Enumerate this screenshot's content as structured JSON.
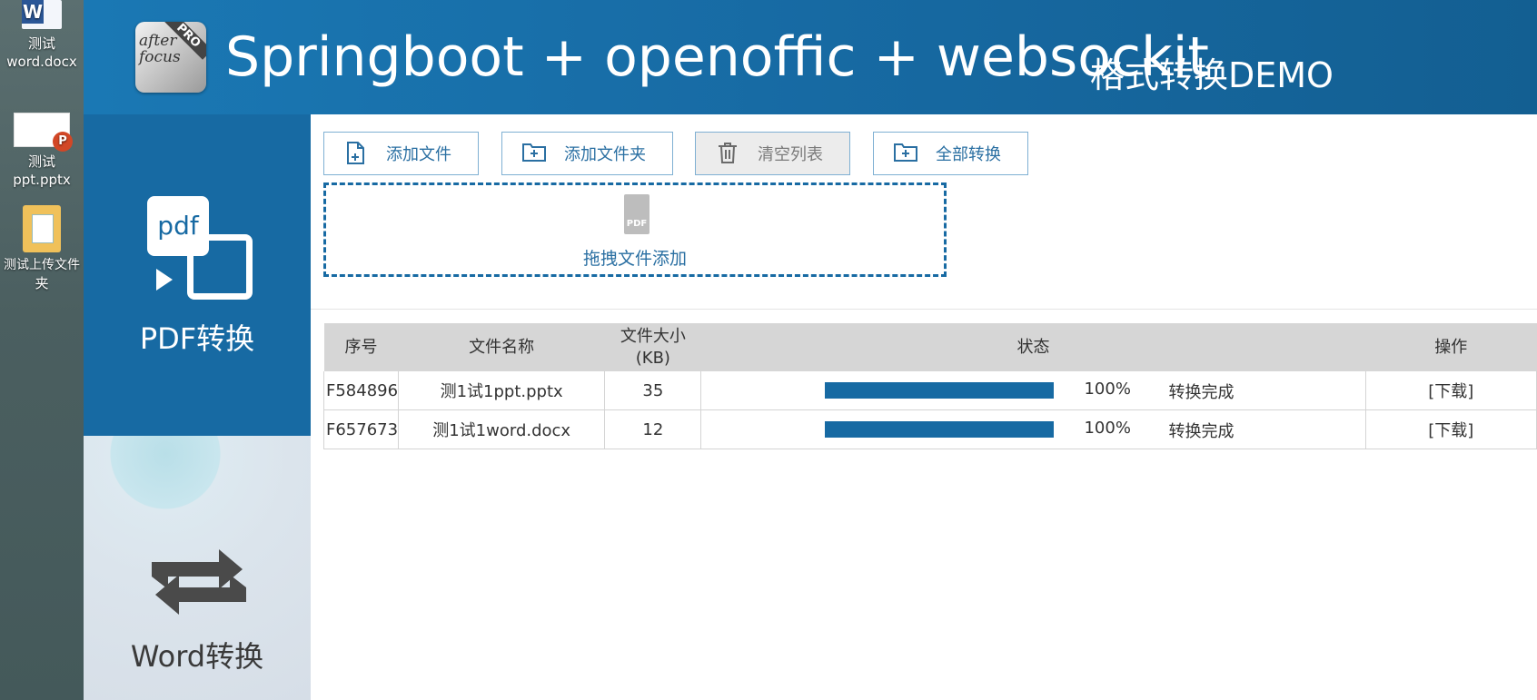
{
  "desktop": {
    "icons": [
      {
        "label_line1": "测试",
        "label_line2": "word.docx",
        "badge": "W"
      },
      {
        "label_line1": "测试",
        "label_line2": "ppt.pptx",
        "badge": "P"
      },
      {
        "label_line1": "测试上传文件",
        "label_line2": "夹"
      }
    ]
  },
  "header": {
    "logo_text": "after focus",
    "logo_badge": "PRO",
    "title": "Springboot + openoffic + websockit",
    "subtitle": "格式转换DEMO"
  },
  "sidebar": {
    "pdf_icon_text": "pdf",
    "pdf_label": "PDF转换",
    "word_label": "Word转换",
    "word_icon": "repeat-icon"
  },
  "toolbar": {
    "add_file": "添加文件",
    "add_folder": "添加文件夹",
    "clear_list": "清空列表",
    "convert_all": "全部转换"
  },
  "dropzone": {
    "icon_text": "PDF",
    "text": "拖拽文件添加"
  },
  "table": {
    "headers": {
      "index": "序号",
      "name": "文件名称",
      "size_line1": "文件大小",
      "size_line2": "(KB)",
      "status": "状态",
      "action": "操作"
    },
    "rows": [
      {
        "id": "F584896",
        "name": "测1试1ppt.pptx",
        "size": "35",
        "progress": 100,
        "percent_text": "100%",
        "status": "转换完成",
        "action": "[下载]"
      },
      {
        "id": "F657673",
        "name": "测1试1word.docx",
        "size": "12",
        "progress": 100,
        "percent_text": "100%",
        "status": "转换完成",
        "action": "[下载]"
      }
    ]
  },
  "colors": {
    "brand_blue": "#176aa3",
    "button_border": "#7fb0d3",
    "table_header_bg": "#d6d6d6"
  }
}
